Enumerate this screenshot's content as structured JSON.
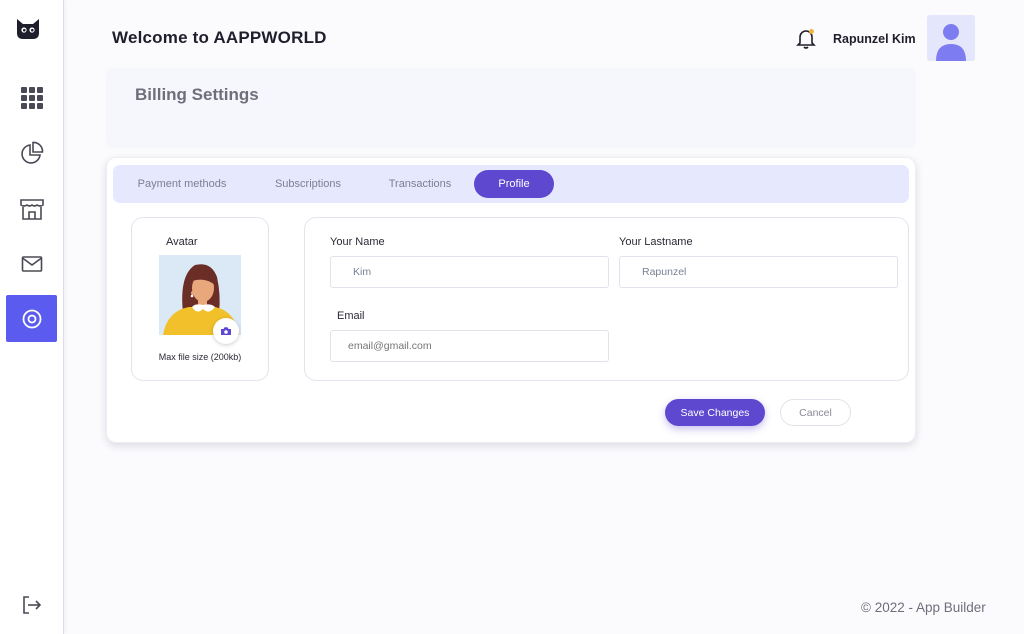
{
  "header": {
    "title": "Welcome to AAPPWORLD",
    "user_name": "Rapunzel Kim"
  },
  "sidebar": {
    "items": [
      {
        "icon": "grid-icon"
      },
      {
        "icon": "pie-chart-icon"
      },
      {
        "icon": "store-icon"
      },
      {
        "icon": "mail-icon"
      },
      {
        "icon": "target-icon",
        "active": true
      }
    ],
    "logout_icon": "logout-icon"
  },
  "banner": {
    "title": "Billing Settings"
  },
  "tabs": [
    {
      "label": "Payment methods",
      "active": false
    },
    {
      "label": "Subscriptions",
      "active": false
    },
    {
      "label": "Transactions",
      "active": false
    },
    {
      "label": "Profile",
      "active": true
    }
  ],
  "avatar_panel": {
    "label": "Avatar",
    "note": "Max file size (200kb)"
  },
  "form": {
    "name_label": "Your Name",
    "name_value": "Kim",
    "lastname_label": "Your Lastname",
    "lastname_value": "Rapunzel",
    "email_label": "Email",
    "email_placeholder": "email@gmail.com"
  },
  "buttons": {
    "save": "Save Changes",
    "cancel": "Cancel"
  },
  "footer": {
    "text": "© 2022 - App Builder"
  },
  "colors": {
    "accent": "#5b5bf0",
    "primary_button": "#5e48cf",
    "tab_bar": "#e6e9fd"
  }
}
